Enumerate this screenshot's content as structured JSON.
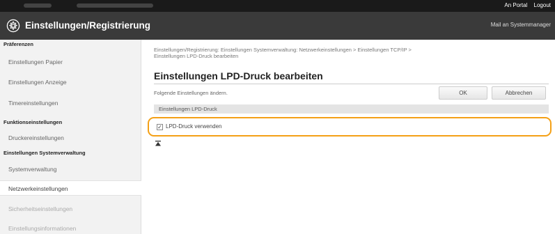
{
  "topbar": {
    "portal_link": "An Portal",
    "logout_link": "Logout"
  },
  "header": {
    "title": "Einstellungen/Registrierung",
    "mail_link": "Mail an Systemmanager"
  },
  "sidebar": {
    "sections": [
      {
        "label": "Präferenzen",
        "items": [
          "Einstellungen Papier",
          "Einstellungen Anzeige",
          "Timereinstellungen"
        ]
      },
      {
        "label": "Funktionseinstellungen",
        "items": [
          "Druckereinstellungen"
        ]
      },
      {
        "label": "Einstellungen Systemverwaltung",
        "items": [
          "Systemverwaltung",
          "Netzwerkeinstellungen",
          "Sicherheitseinstellungen",
          "Einstellungsinformationen"
        ]
      }
    ]
  },
  "main": {
    "breadcrumb_line1": "Einstellungen/Registrierung: Einstellungen Systemverwaltung: Netzwerkeinstellungen > Einstellungen TCP/IP >",
    "breadcrumb_line2": "Einstellungen LPD-Druck bearbeiten",
    "page_title": "Einstellungen LPD-Druck bearbeiten",
    "instruction": "Folgende Einstellungen ändern.",
    "ok_label": "OK",
    "cancel_label": "Abbrechen",
    "section_header": "Einstellungen LPD-Druck",
    "checkbox_label": "LPD-Druck verwenden",
    "checkbox_checked": true
  },
  "colors": {
    "highlight": "#f4a016",
    "header_bg": "#3a3a3a",
    "topbar_bg": "#1a1a1a"
  },
  "icons": {
    "header": "gear-icon",
    "back_to_top": "back-to-top-icon"
  }
}
